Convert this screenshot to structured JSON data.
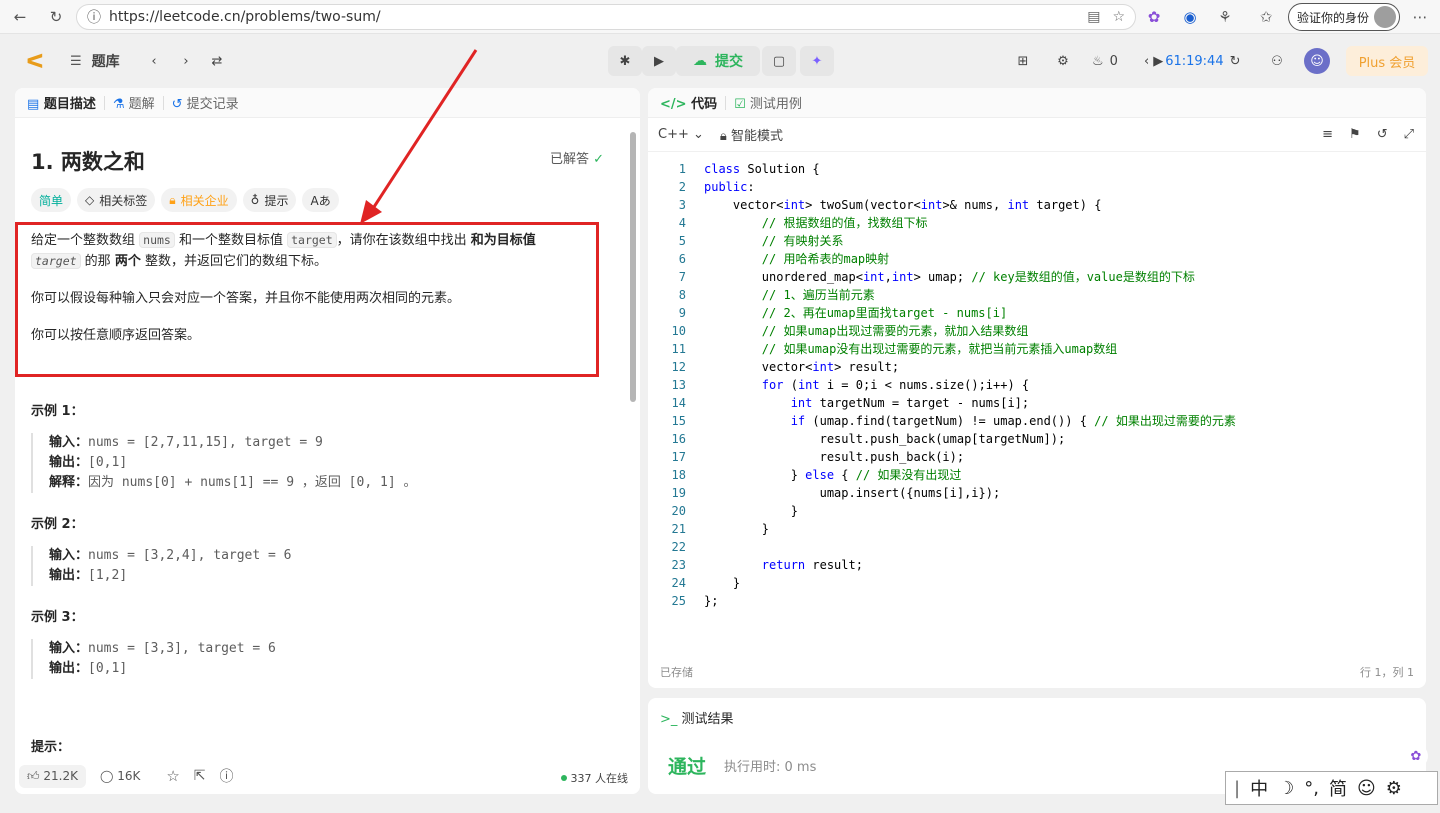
{
  "browser": {
    "url": "https://leetcode.cn/problems/two-sum/",
    "verify_label": "验证你的身份"
  },
  "topbar": {
    "problem_list": "题库",
    "submit": "提交",
    "streak": "0",
    "timer": "61:19:44",
    "plus": "Plus 会员"
  },
  "left": {
    "tabs": [
      "题目描述",
      "题解",
      "提交记录"
    ],
    "title": "1. 两数之和",
    "solved": "已解答",
    "tags": [
      "简单",
      "相关标签",
      "相关企业",
      "提示",
      "Aあ"
    ],
    "desc": {
      "p1a": "给定一个整数数组 ",
      "nums": "nums",
      "p1b": " 和一个整数目标值 ",
      "target": "target",
      "p1c": "，请你在该数组中找出 ",
      "p1d": "和为目标值",
      "target2": "target",
      "p1e": " 的那 ",
      "p1f": "两个",
      "p1g": " 整数，并返回它们的数组下标。",
      "p2": "你可以假设每种输入只会对应一个答案，并且你不能使用两次相同的元素。",
      "p3": "你可以按任意顺序返回答案。"
    },
    "examples": [
      {
        "head": "示例 1：",
        "lines": [
          [
            "输入：",
            "nums = [2,7,11,15], target = 9"
          ],
          [
            "输出：",
            "[0,1]"
          ],
          [
            "解释：",
            "因为 nums[0] + nums[1] == 9 ，返回 [0, 1] 。"
          ]
        ]
      },
      {
        "head": "示例 2：",
        "lines": [
          [
            "输入：",
            "nums = [3,2,4], target = 6"
          ],
          [
            "输出：",
            "[1,2]"
          ]
        ]
      },
      {
        "head": "示例 3：",
        "lines": [
          [
            "输入：",
            "nums = [3,3], target = 6"
          ],
          [
            "输出：",
            "[0,1]"
          ]
        ]
      }
    ],
    "hint_head": "提示：",
    "footer": {
      "likes": "21.2K",
      "comments": "16K",
      "online": "337 人在线"
    }
  },
  "code": {
    "tab_code": "代码",
    "tab_test": "测试用例",
    "lang": "C++",
    "mode": "智能模式",
    "saved": "已存储",
    "pos": "行 1，列 1",
    "lines": [
      [
        [
          "kw",
          "class"
        ],
        [
          "t",
          " Solution {"
        ]
      ],
      [
        [
          "kw",
          "public"
        ],
        [
          "t",
          ":"
        ]
      ],
      [
        [
          "t",
          "    vector<"
        ],
        [
          "kw",
          "int"
        ],
        [
          "t",
          "> twoSum(vector<"
        ],
        [
          "kw",
          "int"
        ],
        [
          "t",
          ">& nums, "
        ],
        [
          "kw",
          "int"
        ],
        [
          "t",
          " target) {"
        ]
      ],
      [
        [
          "cm",
          "        // 根据数组的值，找数组下标"
        ]
      ],
      [
        [
          "cm",
          "        // 有映射关系"
        ]
      ],
      [
        [
          "cm",
          "        // 用哈希表的map映射"
        ]
      ],
      [
        [
          "t",
          "        unordered_map<"
        ],
        [
          "kw",
          "int"
        ],
        [
          "t",
          ","
        ],
        [
          "kw",
          "int"
        ],
        [
          "t",
          "> umap; "
        ],
        [
          "cm",
          "// key是数组的值，value是数组的下标"
        ]
      ],
      [
        [
          "cm",
          "        // 1、遍历当前元素"
        ]
      ],
      [
        [
          "cm",
          "        // 2、再在umap里面找target - nums[i]"
        ]
      ],
      [
        [
          "cm",
          "        // 如果umap出现过需要的元素，就加入结果数组"
        ]
      ],
      [
        [
          "cm",
          "        // 如果umap没有出现过需要的元素，就把当前元素插入umap数组"
        ]
      ],
      [
        [
          "t",
          "        vector<"
        ],
        [
          "kw",
          "int"
        ],
        [
          "t",
          "> result;"
        ]
      ],
      [
        [
          "t",
          "        "
        ],
        [
          "kw",
          "for"
        ],
        [
          "t",
          " ("
        ],
        [
          "kw",
          "int"
        ],
        [
          "t",
          " i = 0;i < nums.size();i++) {"
        ]
      ],
      [
        [
          "t",
          "            "
        ],
        [
          "kw",
          "int"
        ],
        [
          "t",
          " targetNum = target - nums[i];"
        ]
      ],
      [
        [
          "t",
          "            "
        ],
        [
          "kw",
          "if"
        ],
        [
          "t",
          " (umap.find(targetNum) != umap.end()) { "
        ],
        [
          "cm",
          "// 如果出现过需要的元素"
        ]
      ],
      [
        [
          "t",
          "                result.push_back(umap[targetNum]);"
        ]
      ],
      [
        [
          "t",
          "                result.push_back(i);"
        ]
      ],
      [
        [
          "t",
          "            } "
        ],
        [
          "kw",
          "else"
        ],
        [
          "t",
          " { "
        ],
        [
          "cm",
          "// 如果没有出现过"
        ]
      ],
      [
        [
          "t",
          "                umap.insert({nums[i],i});"
        ]
      ],
      [
        [
          "t",
          "            }"
        ]
      ],
      [
        [
          "t",
          "        }"
        ]
      ],
      [
        [
          "t",
          ""
        ]
      ],
      [
        [
          "t",
          "        "
        ],
        [
          "kw",
          "return"
        ],
        [
          "t",
          " result;"
        ]
      ],
      [
        [
          "t",
          "    }"
        ]
      ],
      [
        [
          "t",
          "};"
        ]
      ]
    ]
  },
  "result": {
    "head": "测试结果",
    "pass": "通过",
    "runtime": "执行用时: 0 ms"
  },
  "ime": {
    "items": [
      "中",
      "☽",
      "°,",
      "简",
      "☺",
      "⚙"
    ]
  }
}
